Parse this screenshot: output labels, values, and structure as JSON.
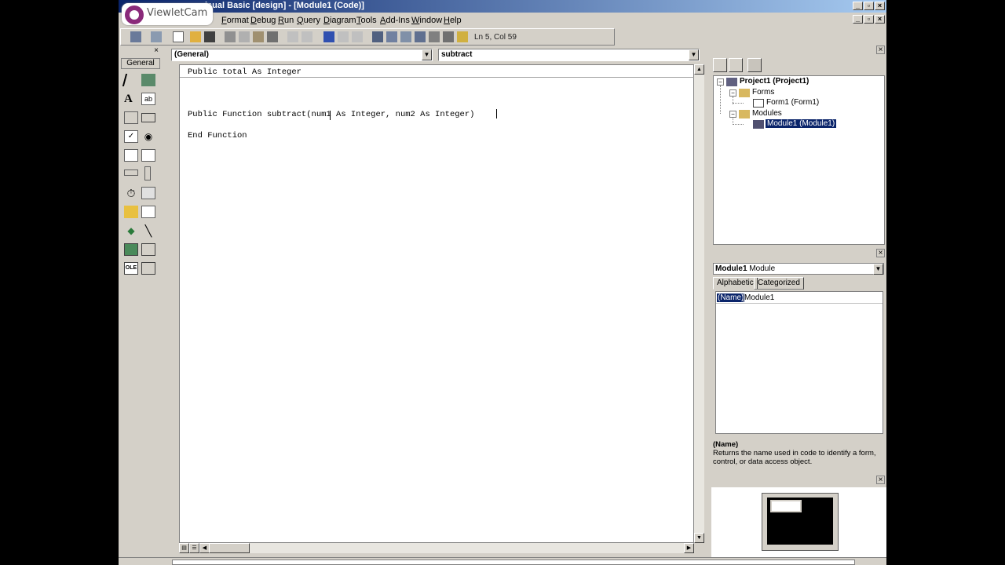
{
  "app": {
    "title": "isual Basic [design] - [Module1 (Code)]",
    "watermark": "ViewletCam"
  },
  "menu": [
    "Format",
    "Debug",
    "Run",
    "Query",
    "Diagram",
    "Tools",
    "Add-Ins",
    "Window",
    "Help"
  ],
  "toolbar": {
    "position": "Ln 5, Col 59"
  },
  "toolbox": {
    "header": "General",
    "tools": [
      "pointer-icon",
      "picturebox-icon",
      "label-icon",
      "textbox-icon",
      "frame-icon",
      "commandbutton-icon",
      "checkbox-icon",
      "optionbutton-icon",
      "combobox-icon",
      "listbox-icon",
      "hscrollbar-icon",
      "vscrollbar-icon",
      "timer-icon",
      "drivelistbox-icon",
      "dirlistbox-icon",
      "filelistbox-icon",
      "shape-icon",
      "line-icon",
      "image-icon",
      "data-icon",
      "ole-icon",
      "grid-icon"
    ]
  },
  "code": {
    "object_combo": "(General)",
    "procedure_combo": "subtract",
    "lines": [
      "Public total As Integer",
      "Public Function subtract(num1 As Integer, num2 As Integer)",
      "End Function"
    ]
  },
  "project": {
    "root": "Project1 (Project1)",
    "forms_folder": "Forms",
    "form1": "Form1 (Form1)",
    "modules_folder": "Modules",
    "module1": "Module1 (Module1)"
  },
  "properties": {
    "object": "Module1",
    "object_type": "Module",
    "tab_alpha": "Alphabetic",
    "tab_cat": "Categorized",
    "prop_name": "(Name)",
    "prop_value": "Module1",
    "desc_title": "(Name)",
    "desc_text": "Returns the name used in code to identify a form, control, or data access object."
  }
}
